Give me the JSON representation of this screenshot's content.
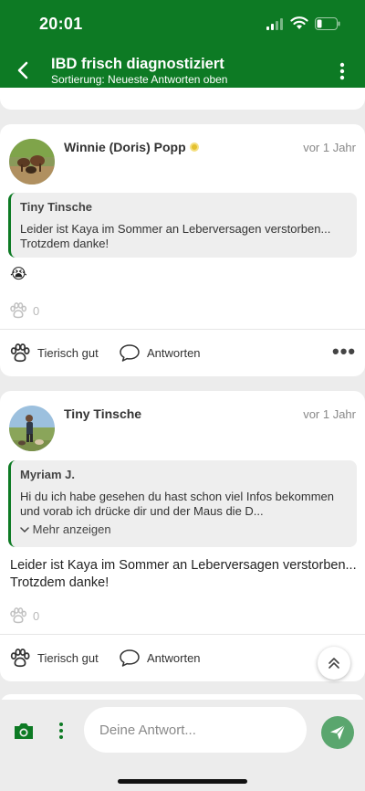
{
  "status_bar": {
    "time": "20:01"
  },
  "header": {
    "title": "IBD frisch diagnostiziert",
    "subtitle": "Sortierung: Neueste Antworten oben"
  },
  "posts": [
    {
      "author": "Winnie (Doris) Popp",
      "age": "vor 1 Jahr",
      "quote": {
        "name": "Tiny Tinsche",
        "text": "Leider ist Kaya im Sommer an Leberversagen verstorben... Trotzdem danke!"
      },
      "body": "😭",
      "likes": "0",
      "like_label": "Tierisch gut",
      "reply_label": "Antworten"
    },
    {
      "author": "Tiny Tinsche",
      "age": "vor 1 Jahr",
      "quote": {
        "name": "Myriam J.",
        "text": "Hi du ich habe gesehen du hast schon viel Infos bekommen und vorab ich drücke dir und der Maus die D...",
        "more": "Mehr anzeigen"
      },
      "body": "Leider ist Kaya im Sommer an Leberversagen verstorben... Trotzdem danke!",
      "likes": "0",
      "like_label": "Tierisch gut",
      "reply_label": "Antworten"
    }
  ],
  "composer": {
    "placeholder": "Deine Antwort..."
  },
  "colors": {
    "brand_green": "#0d7a24",
    "send_green": "#5aa66e"
  }
}
